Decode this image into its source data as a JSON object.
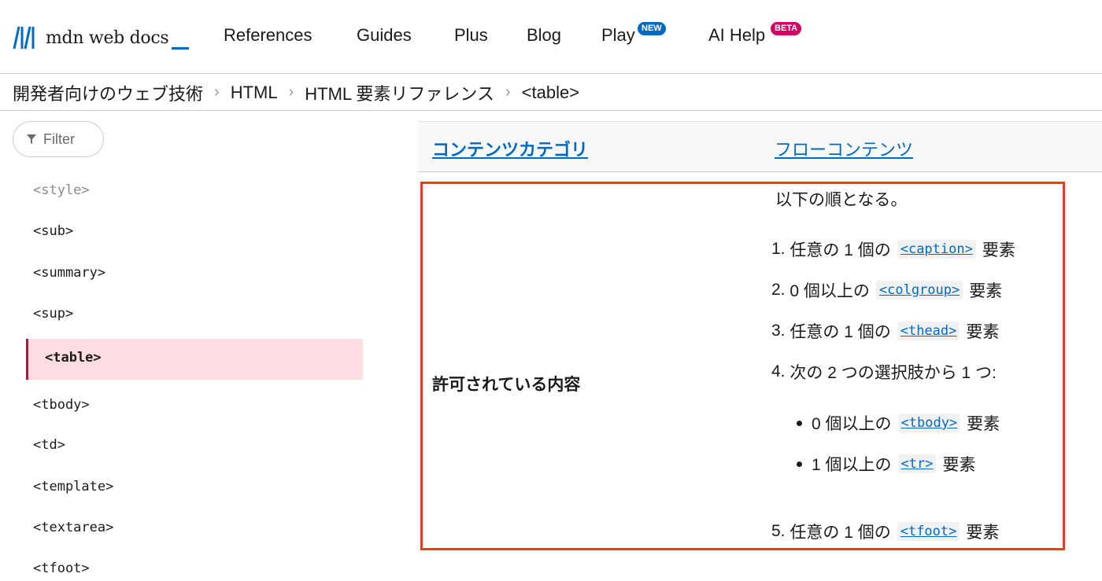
{
  "header": {
    "logo_text": "mdn web docs",
    "nav": [
      {
        "label": "References"
      },
      {
        "label": "Guides"
      },
      {
        "label": "Plus"
      },
      {
        "label": "Blog"
      },
      {
        "label": "Play",
        "badge": "NEW"
      },
      {
        "label": "AI Help",
        "badge": "BETA"
      }
    ]
  },
  "breadcrumb": [
    "開発者向けのウェブ技術",
    "HTML",
    "HTML 要素リファレンス",
    "<table>"
  ],
  "sidebar": {
    "filter_label": "Filter",
    "items": [
      "<style>",
      "<sub>",
      "<summary>",
      "<sup>",
      "<table>",
      "<tbody>",
      "<td>",
      "<template>",
      "<textarea>",
      "<tfoot>"
    ],
    "active": "<table>"
  },
  "table": {
    "row1": {
      "header": "コンテンツカテゴリ",
      "value": "フローコンテンツ"
    },
    "row2": {
      "header": "許可されている内容",
      "intro": "以下の順となる。",
      "items": [
        {
          "num": "1.",
          "pre": "任意の 1 個の",
          "code": "<caption>",
          "post": "要素"
        },
        {
          "num": "2.",
          "pre": "0 個以上の",
          "code": "<colgroup>",
          "post": "要素"
        },
        {
          "num": "3.",
          "pre": "任意の 1 個の",
          "code": "<thead>",
          "post": "要素"
        },
        {
          "num": "4.",
          "pre": "次の 2 つの選択肢から 1 つ:",
          "code": "",
          "post": ""
        },
        {
          "num": "5.",
          "pre": "任意の 1 個の",
          "code": "<tfoot>",
          "post": "要素"
        }
      ],
      "subitems": [
        {
          "pre": "0 個以上の",
          "code": "<tbody>",
          "post": "要素"
        },
        {
          "pre": "1 個以上の",
          "code": "<tr>",
          "post": "要素"
        }
      ]
    }
  },
  "colors": {
    "accent": "#0069c2",
    "highlight_border": "#e8401c",
    "active_bg": "#ffdce1",
    "active_border": "#d30038",
    "badge_new": "#0069c2",
    "badge_beta": "#d30065"
  }
}
